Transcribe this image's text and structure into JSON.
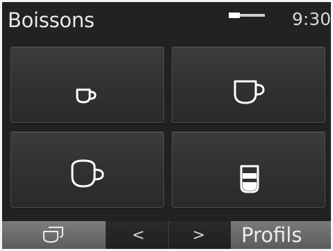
{
  "header": {
    "title": "Boissons",
    "time": "9:30",
    "progress_fraction": 0.3
  },
  "tiles": [
    {
      "icon": "espresso-cup-icon"
    },
    {
      "icon": "coffee-cup-icon"
    },
    {
      "icon": "cappuccino-cup-icon"
    },
    {
      "icon": "latte-glass-icon"
    }
  ],
  "navbar": {
    "home_icon": "cups-icon",
    "prev_label": "<",
    "next_label": ">",
    "profiles_label": "Profils"
  },
  "colors": {
    "background": "#1f1f1f",
    "text": "#e6e6e6",
    "tile": "#333333",
    "bar_button": "#6b6b6b"
  }
}
